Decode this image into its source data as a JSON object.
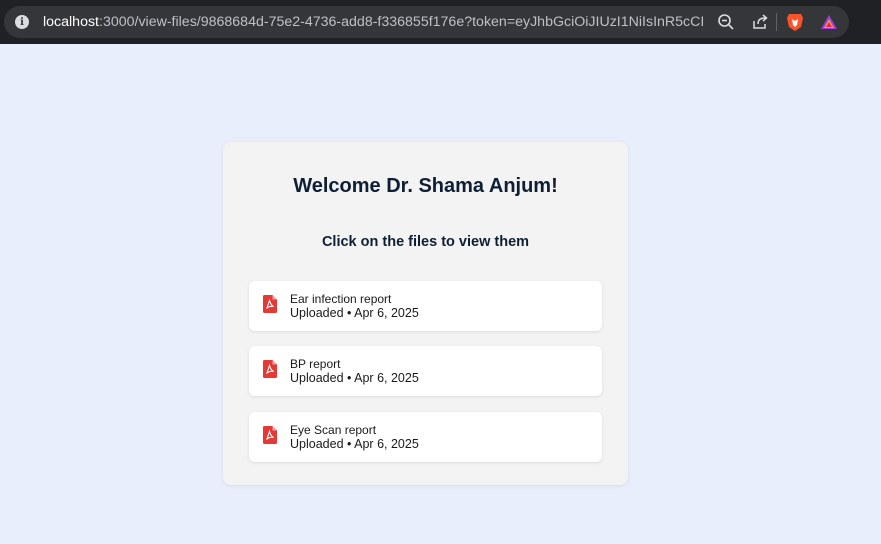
{
  "browser": {
    "url_host": "localhost",
    "url_rest": ":3000/view-files/9868684d-75e2-4736-add8-f336855f176e?token=eyJhbGciOiJIUzI1NiIsInR5cCI6...",
    "icons": [
      "info-icon",
      "zoom-out-icon",
      "share-icon",
      "brave-shield-icon",
      "brave-rewards-icon"
    ]
  },
  "main": {
    "welcome": "Welcome Dr. Shama Anjum!",
    "subtitle": "Click on the files to view them",
    "files": [
      {
        "name": "Ear infection report",
        "meta": "Uploaded • Apr 6, 2025",
        "icon": "pdf-icon"
      },
      {
        "name": "BP report",
        "meta": "Uploaded • Apr 6, 2025",
        "icon": "pdf-icon"
      },
      {
        "name": "Eye Scan report",
        "meta": "Uploaded • Apr 6, 2025",
        "icon": "pdf-icon"
      }
    ]
  },
  "colors": {
    "background": "#e8eefb",
    "card": "#f3f3f3",
    "pdf_red": "#e53935",
    "heading": "#0f1f33"
  }
}
